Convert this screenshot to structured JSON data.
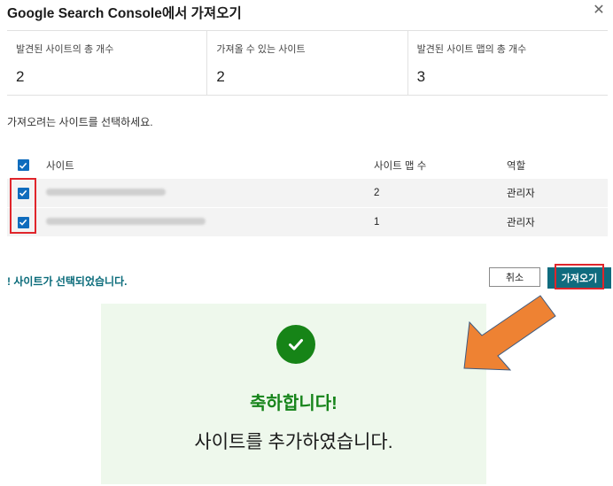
{
  "dialog": {
    "title": "Google Search Console에서 가져오기",
    "close_glyph": "✕"
  },
  "stats": [
    {
      "label": "발견된 사이트의 총 개수",
      "value": "2"
    },
    {
      "label": "가져올 수 있는 사이트",
      "value": "2"
    },
    {
      "label": "발견된 사이트 맵의 총 개수",
      "value": "3"
    }
  ],
  "prompt": "가져오려는 사이트를 선택하세요.",
  "table": {
    "headers": {
      "site": "사이트",
      "sitemaps": "사이트 맵 수",
      "role": "역할"
    },
    "rows": [
      {
        "sitemaps": "2",
        "role": "관리자",
        "checked": true
      },
      {
        "sitemaps": "1",
        "role": "관리자",
        "checked": true
      }
    ]
  },
  "status_text": "! 사이트가 선택되었습니다.",
  "buttons": {
    "cancel": "취소",
    "import": "가져오기"
  },
  "success": {
    "title": "축하합니다!",
    "message": "사이트를 추가하였습니다."
  },
  "colors": {
    "accent": "#0f6b7e",
    "checkbox": "#0f6cbd",
    "success": "#168417",
    "highlight": "#e0252b",
    "arrow": "#ee8233",
    "panel_bg": "#eef8ec"
  },
  "icons": {
    "close": "close-icon",
    "check": "check-icon",
    "success": "checkmark-circle-icon",
    "pointer": "arrow-icon"
  }
}
